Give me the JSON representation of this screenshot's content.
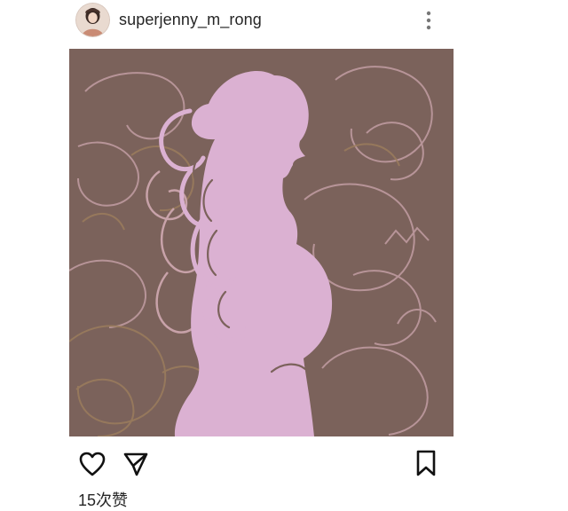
{
  "post": {
    "username": "superjenny_m_rong",
    "likes": "15次赞"
  },
  "icons": {
    "more": "more-vertical-icon",
    "like": "heart-icon",
    "share": "paper-plane-icon",
    "save": "bookmark-icon"
  },
  "colors": {
    "image_background": "#7b625b",
    "silhouette": "#dbb1d2",
    "ornament_light": "#c7a1a8",
    "ornament_gold": "#9b7d5d",
    "text": "#262626"
  }
}
